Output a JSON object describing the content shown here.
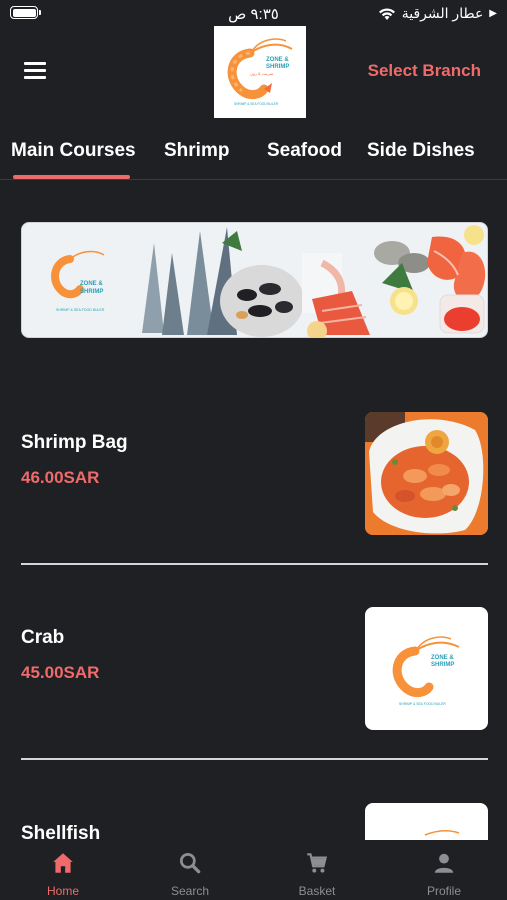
{
  "status_bar": {
    "time": "٩:٣٥ ص",
    "carrier": "عطار الشرقية"
  },
  "header": {
    "select_branch": "Select Branch",
    "logo": {
      "name_line1": "ZONE &",
      "name_line2": "SHRIMP",
      "tagline": "SHRIMP & SEA FOOD BULER"
    }
  },
  "tabs": [
    {
      "label": "Main Courses",
      "active": true
    },
    {
      "label": "Shrimp",
      "active": false
    },
    {
      "label": "Seafood",
      "active": false
    },
    {
      "label": "Side Dishes",
      "active": false
    }
  ],
  "items": [
    {
      "name": "Shrimp Bag",
      "price": "46.00SAR",
      "image": "shrimp-bag-photo"
    },
    {
      "name": "Crab",
      "price": "45.00SAR",
      "image": "logo-placeholder"
    },
    {
      "name": "Shellfish",
      "price": "",
      "image": "logo-placeholder"
    }
  ],
  "bottom_nav": [
    {
      "label": "Home",
      "icon": "home-icon",
      "active": true
    },
    {
      "label": "Search",
      "icon": "search-icon",
      "active": false
    },
    {
      "label": "Basket",
      "icon": "cart-icon",
      "active": false
    },
    {
      "label": "Profile",
      "icon": "person-icon",
      "active": false
    }
  ],
  "colors": {
    "background": "#1f2023",
    "accent": "#ef6b6b",
    "nav_inactive": "#8c8e93"
  }
}
